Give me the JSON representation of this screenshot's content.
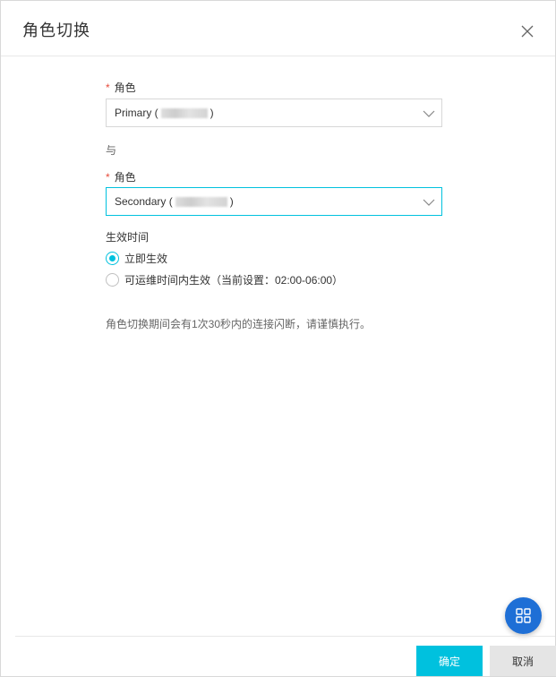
{
  "dialog": {
    "title": "角色切换"
  },
  "form": {
    "required_mark": "*",
    "role1": {
      "label": "角色",
      "prefix": "Primary (",
      "suffix": ")"
    },
    "conjunction": "与",
    "role2": {
      "label": "角色",
      "prefix": "Secondary (",
      "suffix": ")"
    },
    "effective_time": {
      "label": "生效时间",
      "options": [
        {
          "label": "立即生效",
          "checked": true
        },
        {
          "label": "可运维时间内生效（当前设置：02:00-06:00）",
          "checked": false
        }
      ]
    },
    "note": "角色切换期间会有1次30秒内的连接闪断，请谨慎执行。"
  },
  "footer": {
    "ok_label": "确定",
    "cancel_label": "取消"
  },
  "colors": {
    "accent": "#00c1de",
    "required": "#e74c3c",
    "fab": "#1e6fd6"
  },
  "icons": {
    "close": "close-icon",
    "chevron": "chevron-down-icon",
    "fab": "grid-icon"
  }
}
